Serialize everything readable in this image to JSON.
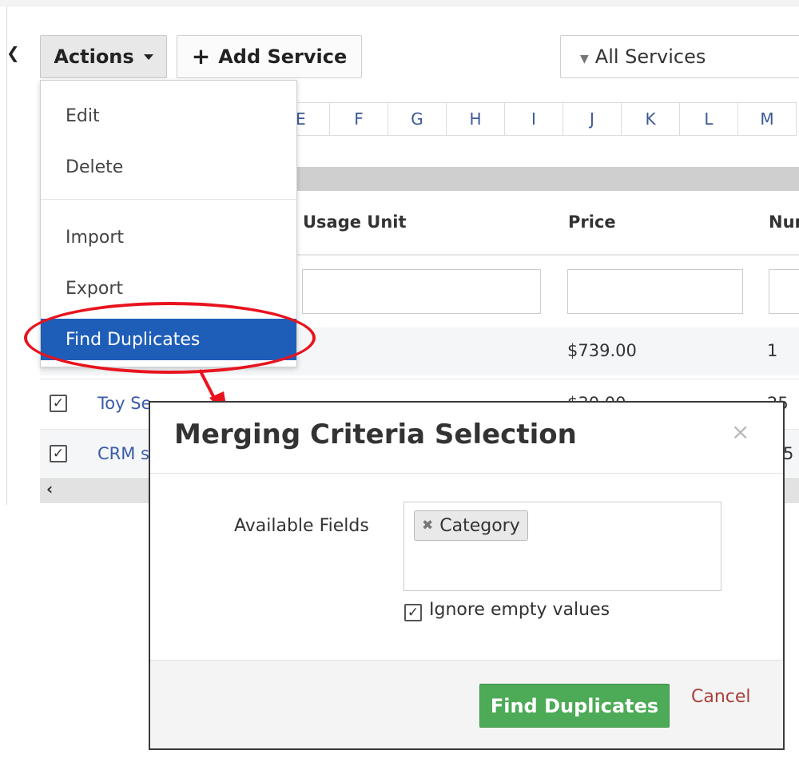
{
  "toolbar": {
    "actions_label": "Actions",
    "add_service_label": "Add Service",
    "filter_label": "All Services"
  },
  "alphabet": [
    "E",
    "F",
    "G",
    "H",
    "I",
    "J",
    "K",
    "L",
    "M"
  ],
  "table": {
    "columns": [
      "Usage Unit",
      "Price",
      "Nur"
    ],
    "rows": [
      {
        "name": "",
        "price": "$739.00",
        "num": "1"
      },
      {
        "name": "Toy Se",
        "price": "$30.00",
        "num": "25"
      },
      {
        "name": "CRM s",
        "price": "",
        "num": "5"
      }
    ]
  },
  "actions_menu": {
    "items": [
      "Edit",
      "Delete",
      "Import",
      "Export",
      "Find Duplicates"
    ],
    "active_item": "Find Duplicates"
  },
  "modal": {
    "title": "Merging Criteria Selection",
    "close_glyph": "×",
    "available_fields_label": "Available Fields",
    "selected_fields": [
      "Category"
    ],
    "ignore_empty_label": "Ignore empty values",
    "ignore_empty_checked": true,
    "find_button_label": "Find Duplicates",
    "cancel_label": "Cancel"
  },
  "colors": {
    "menu_active": "#1e5eb8",
    "find_button": "#4daa57",
    "cancel_link": "#a8403a",
    "annotation": "#e8131e",
    "link": "#3b5aa8"
  }
}
